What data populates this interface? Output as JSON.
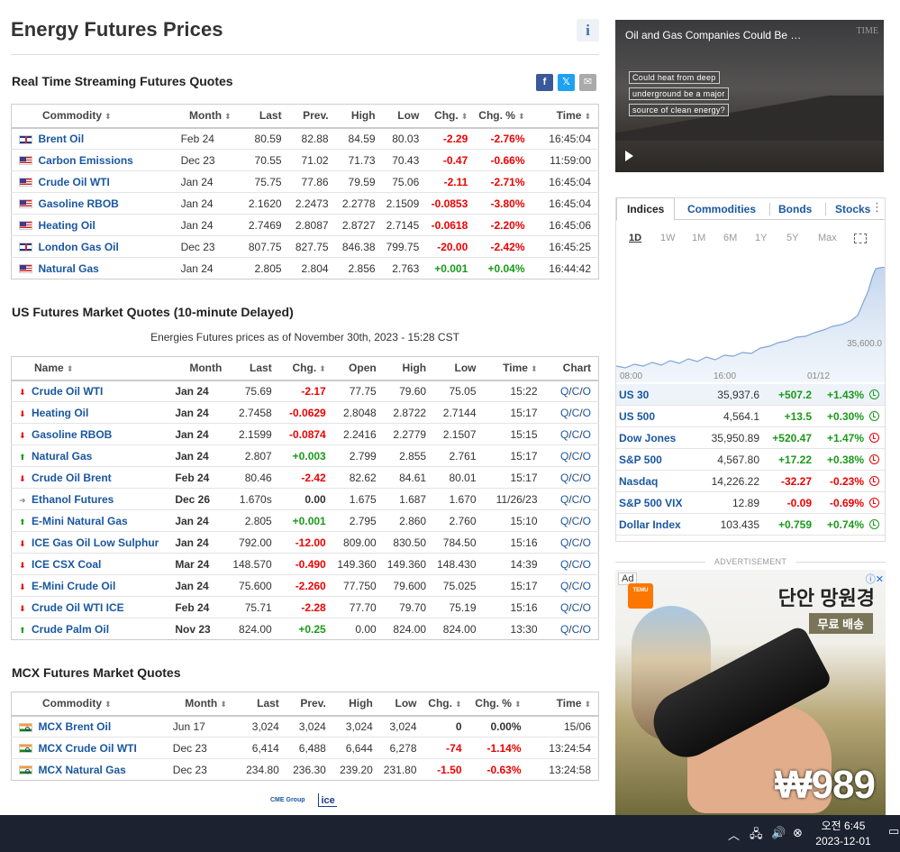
{
  "page": {
    "title": "Energy Futures Prices",
    "info_icon": "info-icon",
    "share": {
      "facebook": "f",
      "x": "𝕏",
      "mail": "✉"
    }
  },
  "realtime": {
    "title": "Real Time Streaming Futures Quotes",
    "headers": [
      "Commodity",
      "Month",
      "Last",
      "Prev.",
      "High",
      "Low",
      "Chg.",
      "Chg. %",
      "Time"
    ],
    "rows": [
      {
        "flag": "uk",
        "name": "Brent Oil",
        "month": "Feb 24",
        "last": "80.59",
        "prev": "82.88",
        "high": "84.59",
        "low": "80.03",
        "chg": "-2.29",
        "chgp": "-2.76%",
        "time": "16:45:04",
        "dir": "neg"
      },
      {
        "flag": "us",
        "name": "Carbon Emissions",
        "month": "Dec 23",
        "last": "70.55",
        "prev": "71.02",
        "high": "71.73",
        "low": "70.43",
        "chg": "-0.47",
        "chgp": "-0.66%",
        "time": "11:59:00",
        "dir": "neg"
      },
      {
        "flag": "us",
        "name": "Crude Oil WTI",
        "month": "Jan 24",
        "last": "75.75",
        "prev": "77.86",
        "high": "79.59",
        "low": "75.06",
        "chg": "-2.11",
        "chgp": "-2.71%",
        "time": "16:45:04",
        "dir": "neg"
      },
      {
        "flag": "us",
        "name": "Gasoline RBOB",
        "month": "Jan 24",
        "last": "2.1620",
        "prev": "2.2473",
        "high": "2.2778",
        "low": "2.1509",
        "chg": "-0.0853",
        "chgp": "-3.80%",
        "time": "16:45:04",
        "dir": "neg"
      },
      {
        "flag": "us",
        "name": "Heating Oil",
        "month": "Jan 24",
        "last": "2.7469",
        "prev": "2.8087",
        "high": "2.8727",
        "low": "2.7145",
        "chg": "-0.0618",
        "chgp": "-2.20%",
        "time": "16:45:06",
        "dir": "neg"
      },
      {
        "flag": "uk",
        "name": "London Gas Oil",
        "month": "Dec 23",
        "last": "807.75",
        "prev": "827.75",
        "high": "846.38",
        "low": "799.75",
        "chg": "-20.00",
        "chgp": "-2.42%",
        "time": "16:45:25",
        "dir": "neg"
      },
      {
        "flag": "us",
        "name": "Natural Gas",
        "month": "Jan 24",
        "last": "2.805",
        "prev": "2.804",
        "high": "2.856",
        "low": "2.763",
        "chg": "+0.001",
        "chgp": "+0.04%",
        "time": "16:44:42",
        "dir": "pos"
      }
    ]
  },
  "us_futures": {
    "title": "US Futures Market Quotes (10-minute Delayed)",
    "note": "Energies Futures prices as of November 30th, 2023 - 15:28 CST",
    "headers": [
      "Name",
      "Month",
      "Last",
      "Chg.",
      "Open",
      "High",
      "Low",
      "Time",
      "Chart"
    ],
    "chart_links": {
      "q": "Q",
      "c": "C",
      "o": "O",
      "sep": "/"
    },
    "rows": [
      {
        "arrow": "down",
        "name": "Crude Oil WTI",
        "month": "Jan 24",
        "last": "75.69",
        "chg": "-2.17",
        "open": "77.75",
        "high": "79.60",
        "low": "75.05",
        "time": "15:22",
        "dir": "neg"
      },
      {
        "arrow": "down",
        "name": "Heating Oil",
        "month": "Jan 24",
        "last": "2.7458",
        "chg": "-0.0629",
        "open": "2.8048",
        "high": "2.8722",
        "low": "2.7144",
        "time": "15:17",
        "dir": "neg"
      },
      {
        "arrow": "down",
        "name": "Gasoline RBOB",
        "month": "Jan 24",
        "last": "2.1599",
        "chg": "-0.0874",
        "open": "2.2416",
        "high": "2.2779",
        "low": "2.1507",
        "time": "15:15",
        "dir": "neg"
      },
      {
        "arrow": "up",
        "name": "Natural Gas",
        "month": "Jan 24",
        "last": "2.807",
        "chg": "+0.003",
        "open": "2.799",
        "high": "2.855",
        "low": "2.761",
        "time": "15:17",
        "dir": "pos"
      },
      {
        "arrow": "down",
        "name": "Crude Oil Brent",
        "month": "Feb 24",
        "last": "80.46",
        "chg": "-2.42",
        "open": "82.62",
        "high": "84.61",
        "low": "80.01",
        "time": "15:17",
        "dir": "neg"
      },
      {
        "arrow": "flat",
        "name": "Ethanol Futures",
        "month": "Dec 26",
        "last": "1.670s",
        "chg": "0.00",
        "open": "1.675",
        "high": "1.687",
        "low": "1.670",
        "time": "11/26/23",
        "dir": "zero"
      },
      {
        "arrow": "up",
        "name": "E-Mini Natural Gas",
        "month": "Jan 24",
        "last": "2.805",
        "chg": "+0.001",
        "open": "2.795",
        "high": "2.860",
        "low": "2.760",
        "time": "15:10",
        "dir": "pos"
      },
      {
        "arrow": "down",
        "name": "ICE Gas Oil Low Sulphur",
        "month": "Jan 24",
        "last": "792.00",
        "chg": "-12.00",
        "open": "809.00",
        "high": "830.50",
        "low": "784.50",
        "time": "15:16",
        "dir": "neg"
      },
      {
        "arrow": "down",
        "name": "ICE CSX Coal",
        "month": "Mar 24",
        "last": "148.570",
        "chg": "-0.490",
        "open": "149.360",
        "high": "149.360",
        "low": "148.430",
        "time": "14:39",
        "dir": "neg"
      },
      {
        "arrow": "down",
        "name": "E-Mini Crude Oil",
        "month": "Jan 24",
        "last": "75.600",
        "chg": "-2.260",
        "open": "77.750",
        "high": "79.600",
        "low": "75.025",
        "time": "15:17",
        "dir": "neg"
      },
      {
        "arrow": "down",
        "name": "Crude Oil WTI ICE",
        "month": "Feb 24",
        "last": "75.71",
        "chg": "-2.28",
        "open": "77.70",
        "high": "79.70",
        "low": "75.19",
        "time": "15:16",
        "dir": "neg"
      },
      {
        "arrow": "up",
        "name": "Crude Palm Oil",
        "month": "Nov 23",
        "last": "824.00",
        "chg": "+0.25",
        "open": "0.00",
        "high": "824.00",
        "low": "824.00",
        "time": "13:30",
        "dir": "pos"
      }
    ]
  },
  "mcx": {
    "title": "MCX Futures Market Quotes",
    "headers": [
      "Commodity",
      "Month",
      "Last",
      "Prev.",
      "High",
      "Low",
      "Chg.",
      "Chg. %",
      "Time"
    ],
    "rows": [
      {
        "flag": "in",
        "name": "MCX Brent Oil",
        "month": "Jun 17",
        "last": "3,024",
        "prev": "3,024",
        "high": "3,024",
        "low": "3,024",
        "chg": "0",
        "chgp": "0.00%",
        "time": "15/06",
        "dir": "zero"
      },
      {
        "flag": "in",
        "name": "MCX Crude Oil WTI",
        "month": "Dec 23",
        "last": "6,414",
        "prev": "6,488",
        "high": "6,644",
        "low": "6,278",
        "chg": "-74",
        "chgp": "-1.14%",
        "time": "13:24:54",
        "dir": "neg"
      },
      {
        "flag": "in",
        "name": "MCX Natural Gas",
        "month": "Dec 23",
        "last": "234.80",
        "prev": "236.30",
        "high": "239.20",
        "low": "231.80",
        "chg": "-1.50",
        "chgp": "-0.63%",
        "time": "13:24:58",
        "dir": "neg"
      }
    ]
  },
  "logos": {
    "cme": "CME Group",
    "ice": "ice"
  },
  "video": {
    "title": "Oil and Gas Companies Could Be …",
    "brand": "TIME",
    "captions": [
      "Could heat from deep",
      "underground be a major",
      "source of clean energy?"
    ]
  },
  "widget": {
    "tabs": [
      "Indices",
      "Commodities",
      "Bonds",
      "Stocks"
    ],
    "active_tab": "Indices",
    "ranges": [
      "1D",
      "1W",
      "1M",
      "6M",
      "1Y",
      "5Y",
      "Max"
    ],
    "active_range": "1D",
    "chart_axis": {
      "y_label": "35,600.0",
      "x_labels": [
        "08:00",
        "16:00",
        "01/12"
      ]
    },
    "rows": [
      {
        "name": "US 30",
        "value": "35,937.6",
        "chg": "+507.2",
        "chgp": "+1.43%",
        "dir": "pos",
        "status": "open"
      },
      {
        "name": "US 500",
        "value": "4,564.1",
        "chg": "+13.5",
        "chgp": "+0.30%",
        "dir": "pos",
        "status": "open"
      },
      {
        "name": "Dow Jones",
        "value": "35,950.89",
        "chg": "+520.47",
        "chgp": "+1.47%",
        "dir": "pos",
        "status": "closed"
      },
      {
        "name": "S&P 500",
        "value": "4,567.80",
        "chg": "+17.22",
        "chgp": "+0.38%",
        "dir": "pos",
        "status": "closed"
      },
      {
        "name": "Nasdaq",
        "value": "14,226.22",
        "chg": "-32.27",
        "chgp": "-0.23%",
        "dir": "neg",
        "status": "closed"
      },
      {
        "name": "S&P 500 VIX",
        "value": "12.89",
        "chg": "-0.09",
        "chgp": "-0.69%",
        "dir": "neg",
        "status": "closed"
      },
      {
        "name": "Dollar Index",
        "value": "103.435",
        "chg": "+0.759",
        "chgp": "+0.74%",
        "dir": "pos",
        "status": "open"
      }
    ]
  },
  "ad": {
    "label": "ADVERTISEMENT",
    "badge": "Ad",
    "title": "단안 망원경",
    "subtitle": "무료 배송",
    "price": "₩989",
    "brand": "TEMU"
  },
  "taskbar": {
    "time": "오전 6:45",
    "date": "2023-12-01"
  },
  "colors": {
    "link": "#1a57a0",
    "neg": "#e00000",
    "pos": "#1a9a1a",
    "taskbar": "#1c2230"
  }
}
